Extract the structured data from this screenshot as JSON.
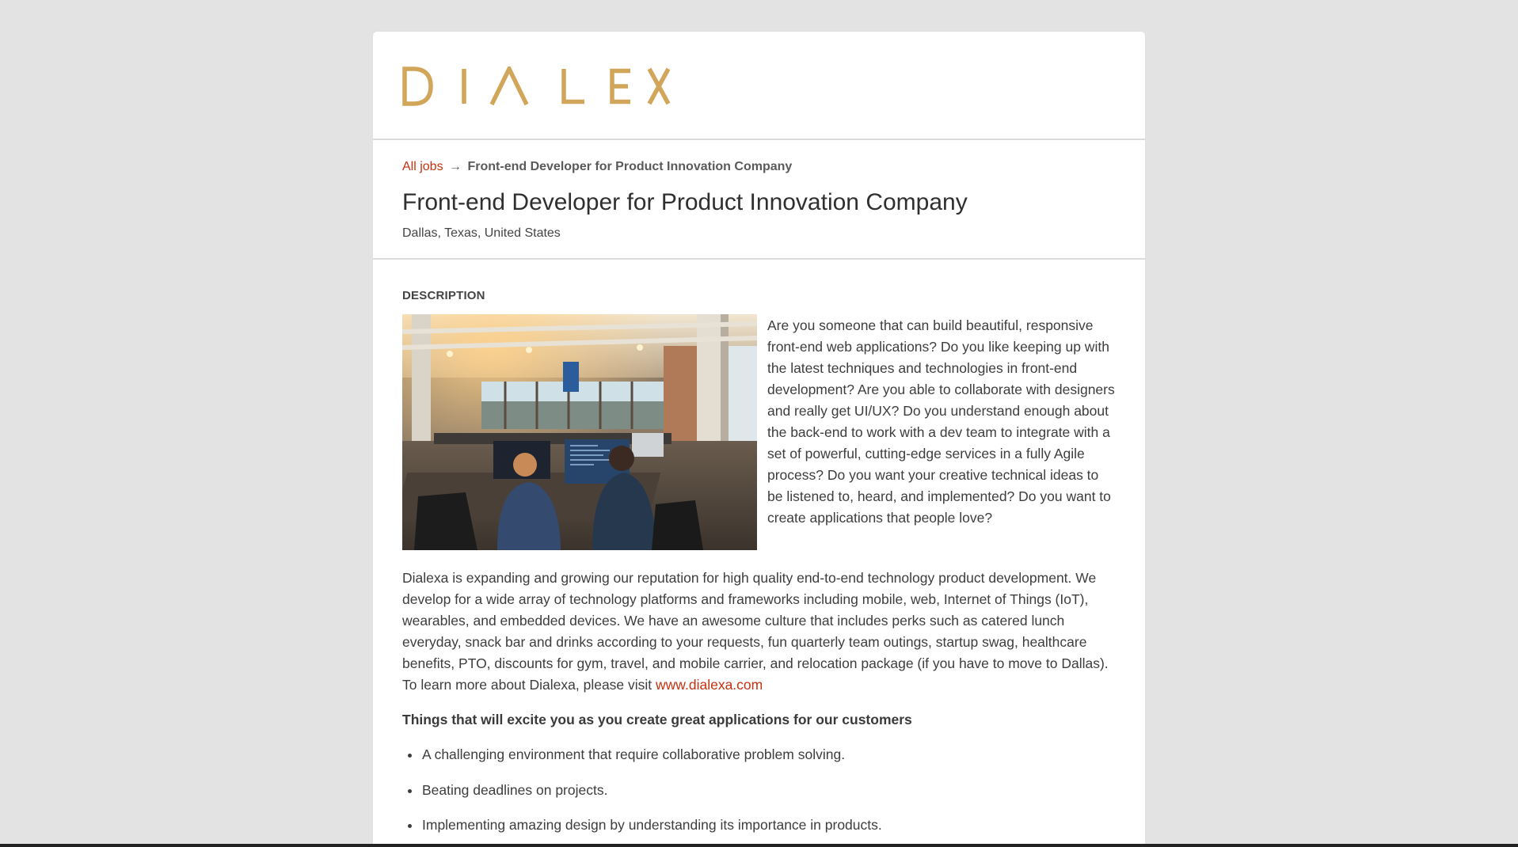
{
  "brand": {
    "logo_text": "DIALEXA",
    "logo_color": "#d2a65a",
    "accent_color": "#c4320f"
  },
  "breadcrumb": {
    "all_jobs_label": "All jobs",
    "separator": "→",
    "current": "Front-end Developer for Product Innovation Company"
  },
  "job": {
    "title": "Front-end Developer for Product Innovation Company",
    "location": "Dallas, Texas, United States"
  },
  "description": {
    "label": "DESCRIPTION",
    "image_alt": "office-photo",
    "intro": "Are you someone that can build beautiful, responsive front-end web applications? Do you like keeping up with the latest techniques and technologies in front-end development? Are you able to collaborate with designers and really get UI/UX? Do you understand enough about the back-end to work with a dev team to integrate with a set of powerful, cutting-edge services in a fully Agile process? Do you want your creative technical ideas to be listened to, heard, and implemented? Do you want to create applications that people love?",
    "company_paragraph": "Dialexa is expanding and growing our reputation for high quality end-to-end technology product development. We develop for a wide array of technology platforms and frameworks including mobile, web, Internet of Things (IoT), wearables, and embedded devices. We have an awesome culture that includes perks such as catered lunch everyday, snack bar and drinks according to your requests, fun quarterly team outings, startup swag, healthcare benefits, PTO, discounts for gym, travel, and mobile carrier, and relocation package (if you have to move to Dallas). To learn more about Dialexa, please visit ",
    "website_link": "www.dialexa.com",
    "excite_heading": "Things that will excite you as you create great applications for our customers",
    "bullets": [
      "A challenging environment that require collaborative problem solving.",
      "Beating deadlines on projects.",
      "Implementing amazing design by understanding its importance in products."
    ]
  }
}
